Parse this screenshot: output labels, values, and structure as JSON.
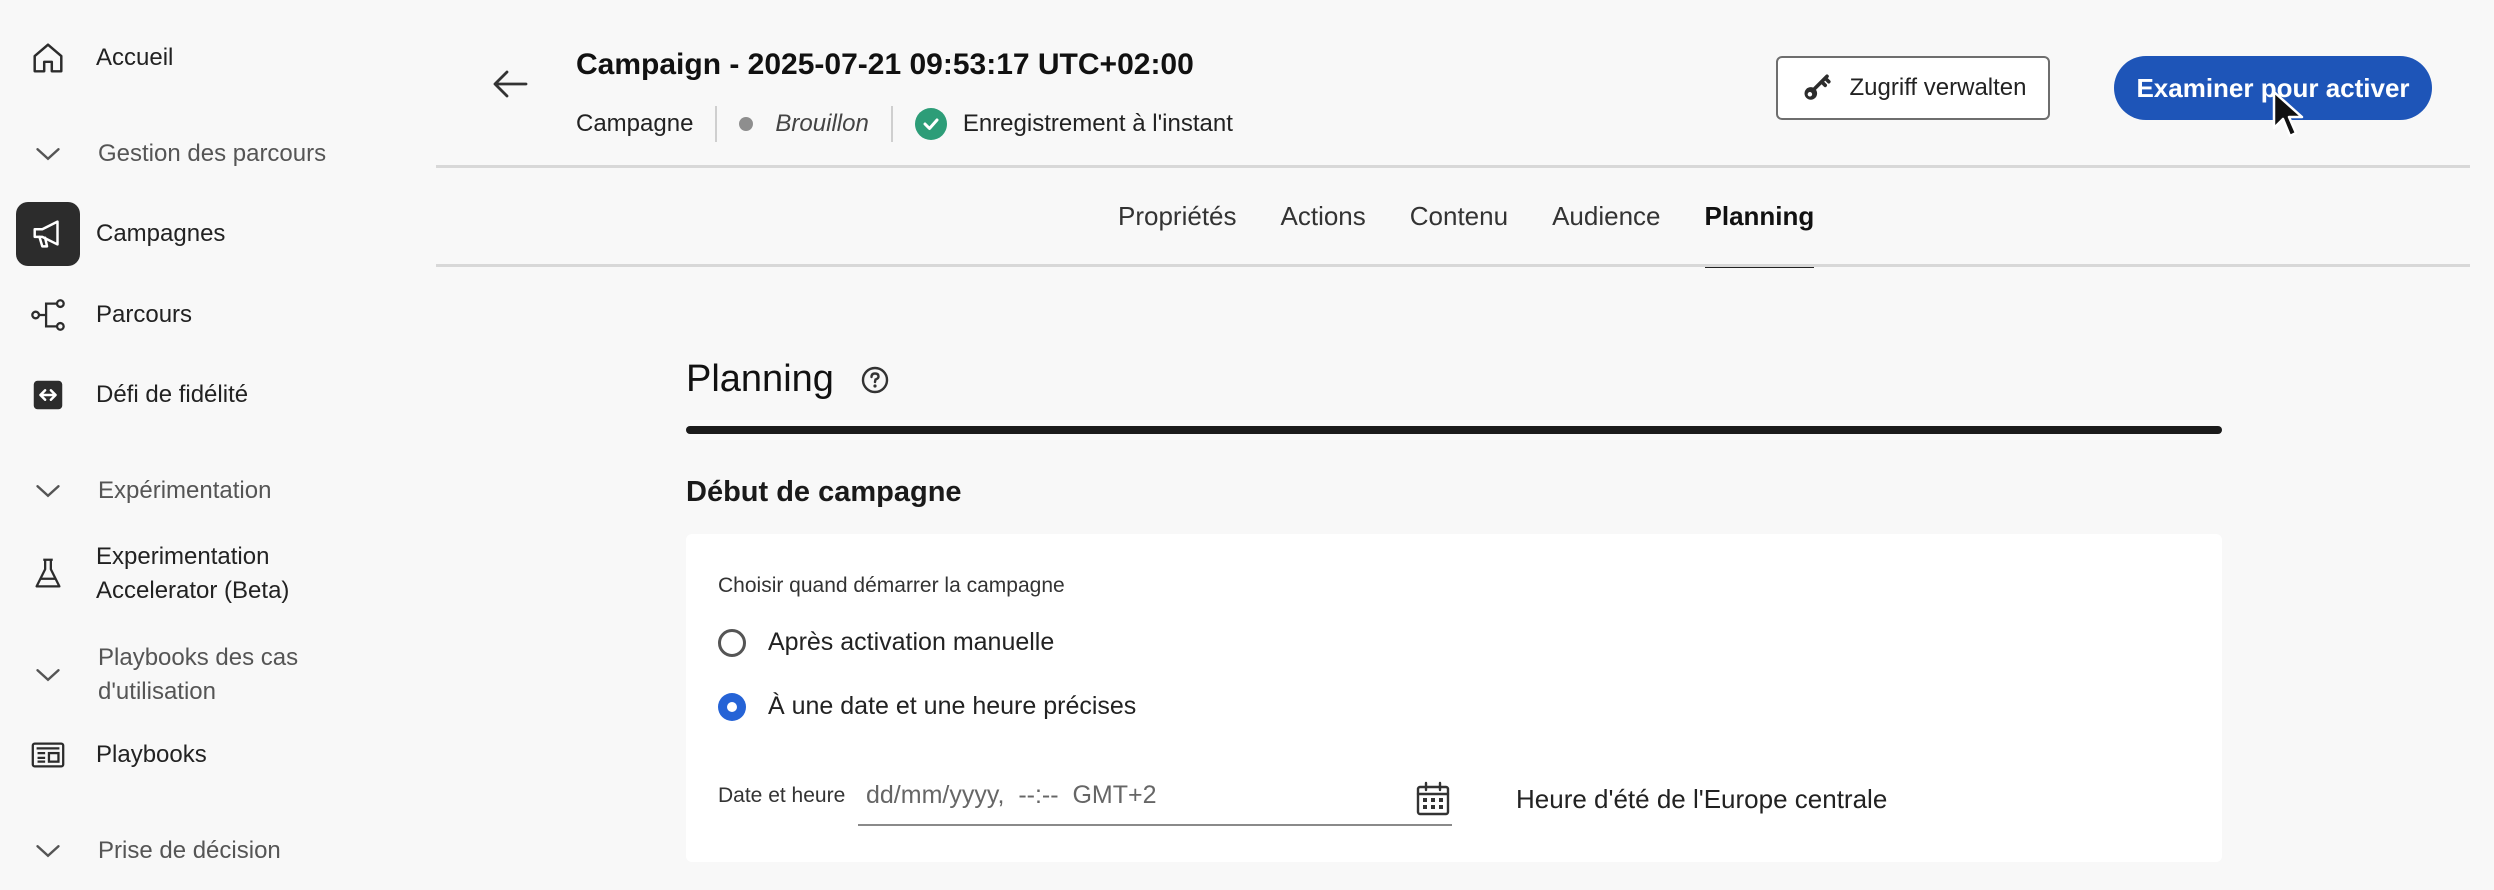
{
  "sidebar": {
    "items": [
      {
        "label": "Accueil",
        "icon": "home-icon"
      },
      {
        "label": "Gestion des parcours",
        "icon": "chevron-down-icon"
      },
      {
        "label": "Campagnes",
        "icon": "megaphone-icon",
        "active": true
      },
      {
        "label": "Parcours",
        "icon": "journey-icon"
      },
      {
        "label": "Défi de fidélité",
        "icon": "loyalty-icon"
      },
      {
        "label": "Expérimentation",
        "icon": "chevron-down-icon"
      },
      {
        "label": "Experimentation Accelerator (Beta)",
        "icon": "flask-icon"
      },
      {
        "label": "Playbooks des cas d'utilisation",
        "icon": "chevron-down-icon"
      },
      {
        "label": "Playbooks",
        "icon": "playbook-icon"
      },
      {
        "label": "Prise de décision",
        "icon": "chevron-down-icon"
      }
    ]
  },
  "header": {
    "title": "Campaign - 2025-07-21 09:53:17 UTC+02:00",
    "type": "Campagne",
    "status": "Brouillon",
    "save_status": "Enregistrement à l'instant",
    "manage_access_label": "Zugriff verwalten",
    "review_label": "Examiner pour activer"
  },
  "tabs": [
    {
      "label": "Propriétés"
    },
    {
      "label": "Actions"
    },
    {
      "label": "Contenu"
    },
    {
      "label": "Audience"
    },
    {
      "label": "Planning",
      "active": true
    }
  ],
  "main": {
    "section_title": "Planning",
    "sub_heading": "Début de campagne",
    "start_label": "Choisir quand démarrer la campagne",
    "option_manual": "Après activation manuelle",
    "option_scheduled": "À une date et une heure précises",
    "selected_option": "À une date et une heure précises",
    "datetime_label": "Date et heure",
    "datetime_placeholder": "dd/mm/yyyy,  --:--  GMT+2",
    "timezone": "Heure d'été de l'Europe centrale"
  },
  "colors": {
    "primary": "#1e55b8",
    "radio_selected": "#2563d6",
    "success": "#2d9d78",
    "sidebar_active": "#2c2c2c"
  }
}
